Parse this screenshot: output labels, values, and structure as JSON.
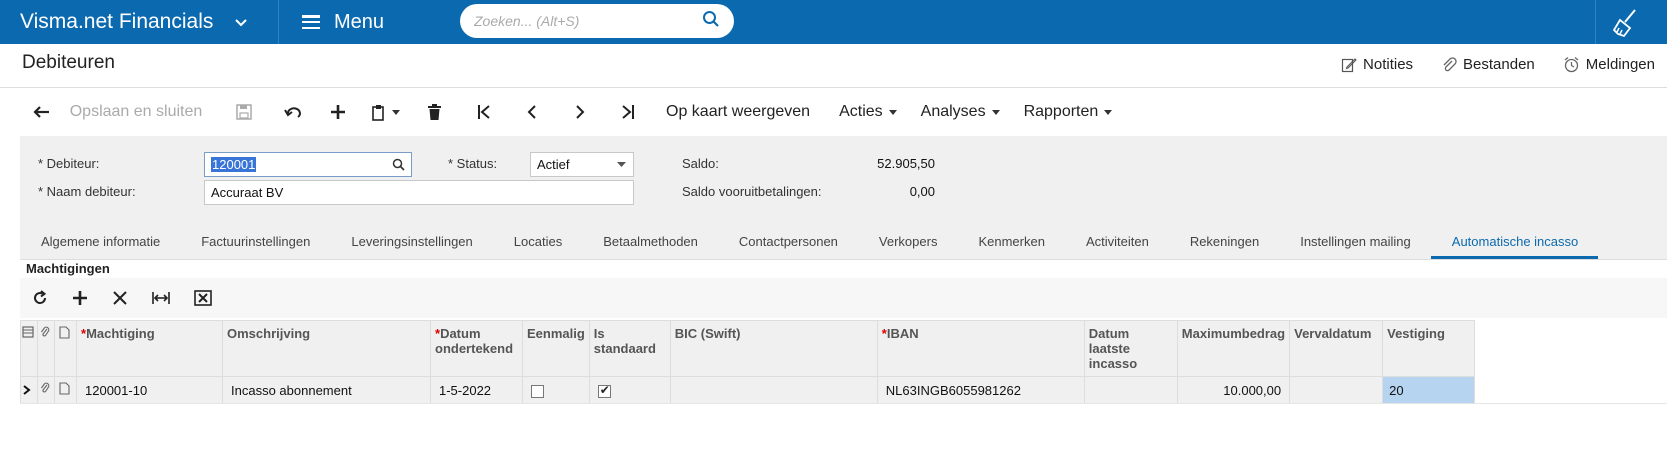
{
  "app": {
    "title": "Visma.net Financials",
    "menu_label": "Menu",
    "search_placeholder": "Zoeken... (Alt+S)"
  },
  "page": {
    "title": "Debiteuren"
  },
  "top_links": {
    "notes": "Notities",
    "files": "Bestanden",
    "notifications": "Meldingen"
  },
  "toolbar": {
    "save_close": "Opslaan en sluiten",
    "show_map": "Op kaart weergeven",
    "actions": "Acties",
    "analyses": "Analyses",
    "reports": "Rapporten"
  },
  "form": {
    "customer_label": "Debiteur:",
    "customer_value": "120001",
    "name_label": "Naam debiteur:",
    "name_value": "Accuraat BV",
    "status_label": "Status:",
    "status_value": "Actief",
    "balance_label": "Saldo:",
    "balance_value": "52.905,50",
    "prepay_label": "Saldo vooruitbetalingen:",
    "prepay_value": "0,00"
  },
  "tabs": [
    "Algemene informatie",
    "Factuurinstellingen",
    "Leveringsinstellingen",
    "Locaties",
    "Betaalmethoden",
    "Contactpersonen",
    "Verkopers",
    "Kenmerken",
    "Activiteiten",
    "Rekeningen",
    "Instellingen mailing",
    "Automatische incasso"
  ],
  "section": {
    "title": "Machtigingen"
  },
  "grid": {
    "columns": {
      "mandate": "Machtiging",
      "description": "Omschrijving",
      "signed_date": "Datum ondertekend",
      "one_time": "Eenmalig",
      "is_default": "Is standaard",
      "bic": "BIC (Swift)",
      "iban": "IBAN",
      "last_collection": "Datum laatste incasso",
      "max_amount": "Maximumbedrag",
      "expiry": "Vervaldatum",
      "branch": "Vestiging"
    },
    "rows": [
      {
        "mandate": "120001-10",
        "description": "Incasso abonnement",
        "signed_date": "1-5-2022",
        "one_time": false,
        "is_default": true,
        "bic": "",
        "iban": "NL63INGB6055981262",
        "last_collection": "",
        "max_amount": "10.000,00",
        "expiry": "",
        "branch": "20"
      }
    ]
  },
  "colors": {
    "brand": "#0b6aaf",
    "active_tab": "#0b6aaf",
    "selected_cell": "#b6d4ef"
  }
}
